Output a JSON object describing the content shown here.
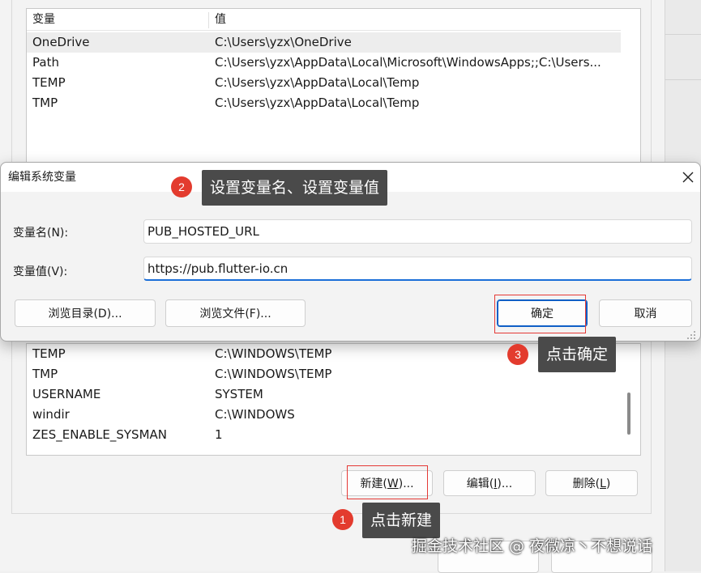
{
  "colors": {
    "accent": "#0f5fc6",
    "annotation_red": "#e33b2e",
    "tooltip_bg": "#4a4a4a"
  },
  "top_list": {
    "headers": [
      "变量",
      "值"
    ],
    "rows": [
      {
        "name": "OneDrive",
        "value": "C:\\Users\\yzx\\OneDrive"
      },
      {
        "name": "Path",
        "value": "C:\\Users\\yzx\\AppData\\Local\\Microsoft\\WindowsApps;;C:\\Users..."
      },
      {
        "name": "TEMP",
        "value": "C:\\Users\\yzx\\AppData\\Local\\Temp"
      },
      {
        "name": "TMP",
        "value": "C:\\Users\\yzx\\AppData\\Local\\Temp"
      }
    ]
  },
  "system_list": {
    "rows": [
      {
        "name": "TEMP",
        "value": "C:\\WINDOWS\\TEMP"
      },
      {
        "name": "TMP",
        "value": "C:\\WINDOWS\\TEMP"
      },
      {
        "name": "USERNAME",
        "value": "SYSTEM"
      },
      {
        "name": "windir",
        "value": "C:\\WINDOWS"
      },
      {
        "name": "ZES_ENABLE_SYSMAN",
        "value": "1"
      }
    ]
  },
  "system_buttons": {
    "new": {
      "text": "新建(",
      "key": "W",
      "suffix": ")..."
    },
    "edit": {
      "text": "编辑(",
      "key": "I",
      "suffix": ")..."
    },
    "delete": {
      "text": "删除(",
      "key": "L",
      "suffix": ")"
    }
  },
  "dialog": {
    "title": "编辑系统变量",
    "name_label": "变量名(N):",
    "name_value": "PUB_HOSTED_URL",
    "value_label": "变量值(V):",
    "value_value": "https://pub.flutter-io.cn",
    "browse_dir": "浏览目录(D)...",
    "browse_file": "浏览文件(F)...",
    "ok": "确定",
    "cancel": "取消"
  },
  "annotations": {
    "step1": {
      "num": "1",
      "text": "点击新建"
    },
    "step2": {
      "num": "2",
      "text": "设置变量名、设置变量值"
    },
    "step3": {
      "num": "3",
      "text": "点击确定"
    }
  },
  "watermark": "掘金技术社区 @ 夜微凉丶不想说话"
}
